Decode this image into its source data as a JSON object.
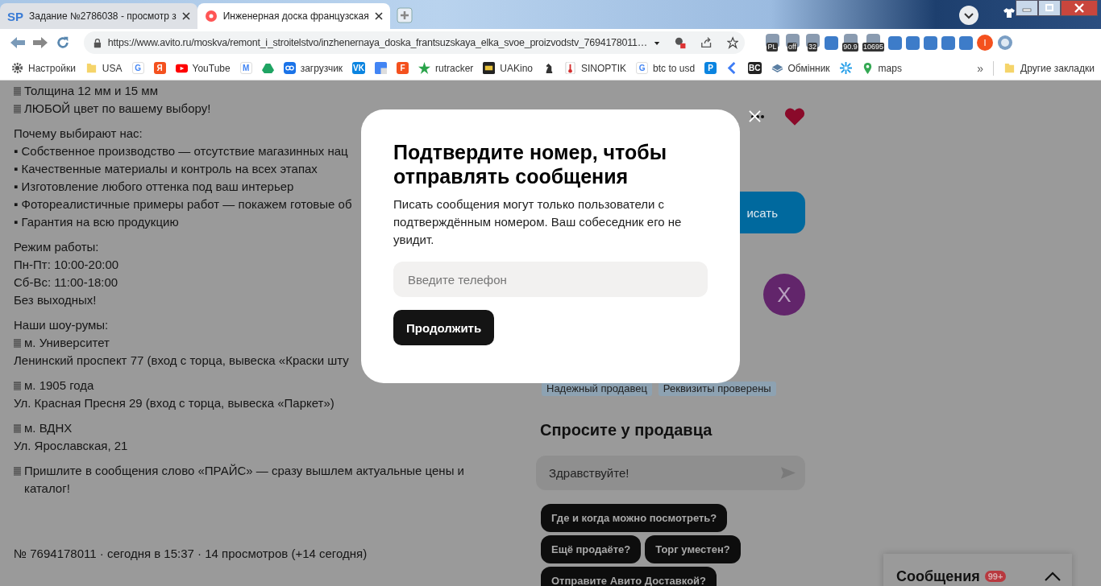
{
  "browser": {
    "tabs": [
      {
        "favicon": "SP",
        "title": "Задание №2786038 - просмотр з",
        "selected": false
      },
      {
        "title": "Инженерная доска французская",
        "selected": true
      }
    ],
    "url": "https://www.avito.ru/moskva/remont_i_stroitelstvo/inzhenernaya_doska_frantsuzskaya_elka_svoe_proizvodstv_7694178011…",
    "extensions": [
      {
        "kind": "badged",
        "badge": "PL"
      },
      {
        "kind": "badged",
        "badge": "off"
      },
      {
        "kind": "badged",
        "badge": "32"
      },
      {
        "kind": "plain"
      },
      {
        "kind": "badged",
        "badge": "90.9"
      },
      {
        "kind": "badged",
        "badge": "10695"
      },
      {
        "kind": "plain"
      },
      {
        "kind": "plain"
      },
      {
        "kind": "plain"
      },
      {
        "kind": "plain"
      },
      {
        "kind": "plain"
      }
    ],
    "profile": "I",
    "bookmarks": [
      {
        "kind": "gear",
        "label": "Настройки"
      },
      {
        "kind": "folder",
        "label": "USA"
      },
      {
        "kind": "outline",
        "glyph": "G"
      },
      {
        "kind": "red",
        "glyph": "Я"
      },
      {
        "kind": "play",
        "label": "YouTube"
      },
      {
        "kind": "outline",
        "glyph": "M"
      },
      {
        "kind": "triangle"
      },
      {
        "kind": "loop",
        "label": "загрузчик"
      },
      {
        "kind": "blue",
        "glyph": "VK"
      },
      {
        "kind": "tile"
      },
      {
        "kind": "red",
        "glyph": "F"
      },
      {
        "kind": "star",
        "label": "rutracker"
      },
      {
        "kind": "screen",
        "label": "UAKino"
      },
      {
        "kind": "knight"
      },
      {
        "kind": "thermo",
        "label": "SINOPTIK"
      },
      {
        "kind": "outline",
        "glyph": "G",
        "label": "btc to usd"
      },
      {
        "kind": "blue",
        "glyph": "P"
      },
      {
        "kind": "chevron"
      },
      {
        "kind": "dark",
        "glyph": "BC"
      },
      {
        "kind": "stack",
        "label": "Обмінник"
      },
      {
        "kind": "spark"
      },
      {
        "kind": "pin",
        "label": "maps"
      }
    ],
    "overflow": "»",
    "other_bookmarks": "Другие закладки"
  },
  "description": [
    [
      {
        "text": "Толщина 12 мм и 15 мм",
        "marked": true
      },
      {
        "text": "ЛЮБОЙ цвет по вашему выбору!",
        "marked": true
      }
    ],
    [
      {
        "text": "Почему выбирают нас:",
        "marked": false
      },
      {
        "text": "▪ Собственное производство — отсутствие магазинных нац",
        "marked": false
      },
      {
        "text": "▪ Качественные материалы и контроль на всех этапах",
        "marked": false
      },
      {
        "text": "▪ Изготовление любого оттенка под ваш интерьер",
        "marked": false
      },
      {
        "text": "▪ Фотореалистичные примеры работ — покажем готовые об",
        "marked": false
      },
      {
        "text": "▪ Гарантия на всю продукцию",
        "marked": false
      }
    ],
    [
      {
        "text": "Режим работы:",
        "marked": false
      },
      {
        "text": "Пн-Пт: 10:00-20:00",
        "marked": false
      },
      {
        "text": "Сб-Вс: 11:00-18:00",
        "marked": false
      },
      {
        "text": "Без выходных!",
        "marked": false
      }
    ],
    [
      {
        "text": "Наши шоу-румы:",
        "marked": false
      },
      {
        "text": "м. Университет",
        "marked": true
      },
      {
        "text": "Ленинский проспект 77 (вход с торца, вывеска «Краски шту",
        "marked": false
      }
    ],
    [
      {
        "text": "м. 1905 года",
        "marked": true
      },
      {
        "text": "Ул. Красная Пресня 29 (вход с торца, вывеска «Паркет»)",
        "marked": false
      }
    ],
    [
      {
        "text": "м. ВДНХ",
        "marked": true
      },
      {
        "text": "Ул. Ярославская, 21",
        "marked": false
      }
    ],
    [
      {
        "text": "Пришлите в сообщения слово «ПРАЙС» — сразу вышлем актуальные цены и каталог!",
        "marked": true
      }
    ]
  ],
  "listing_meta": "№ 7694178011 · сегодня в 15:37 · 14 просмотров (+14 сегодня)",
  "seller": {
    "write_button": "исать",
    "avatar": "X",
    "tags": [
      "Надежный продавец",
      "Реквизиты проверены"
    ]
  },
  "ask_seller": {
    "title": "Спросите у продавца",
    "message": "Здравствуйте!",
    "quick_questions": [
      "Где и когда можно посмотреть?",
      "Ещё продаёте?",
      "Торг уместен?",
      "Отправите Авито Доставкой?"
    ]
  },
  "messages_panel": {
    "title": "Сообщения",
    "badge": "99+"
  },
  "modal": {
    "title": "Подтвердите номер, чтобы отправлять сообщения",
    "text": "Писать сообщения могут только пользователи с подтверждённым номером. Ваш собеседник его не увидит.",
    "phone": {
      "placeholder": "Введите телефон"
    },
    "button": "Продолжить"
  }
}
